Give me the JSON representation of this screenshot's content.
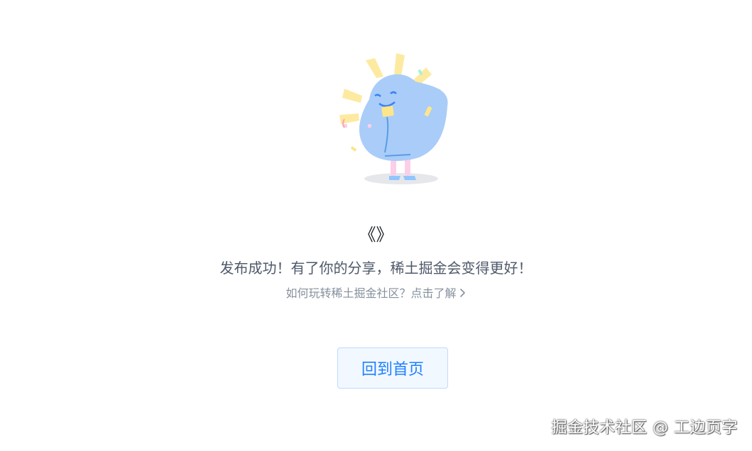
{
  "article": {
    "title": "《》"
  },
  "messages": {
    "success": "发布成功！有了你的分享，稀土掘金会变得更好！",
    "help_link": "如何玩转稀土掘金社区？点击了解"
  },
  "actions": {
    "home_button": "回到首页"
  },
  "watermark": {
    "text": "掘金技术社区 @ 工边页字"
  },
  "colors": {
    "accent": "#1e80ff",
    "button_bg": "#f2f8ff",
    "text_primary": "#1d2129",
    "text_secondary": "#4e5969",
    "text_muted": "#86909c"
  },
  "icons": {
    "mascot": "celebrating-mascot-illustration",
    "help_chevron": "chevron-right-icon"
  }
}
